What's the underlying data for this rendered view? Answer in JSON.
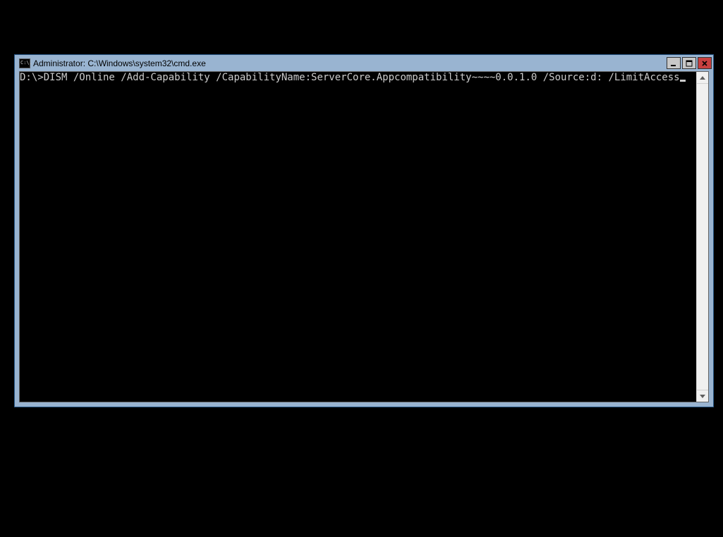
{
  "window": {
    "title": "Administrator: C:\\Windows\\system32\\cmd.exe",
    "icon_label": "C:\\."
  },
  "console": {
    "prompt": "D:\\>",
    "command": "DISM /Online /Add-Capability /CapabilityName:ServerCore.Appcompatibility~~~~0.0.1.0 /Source:d: /LimitAccess"
  }
}
